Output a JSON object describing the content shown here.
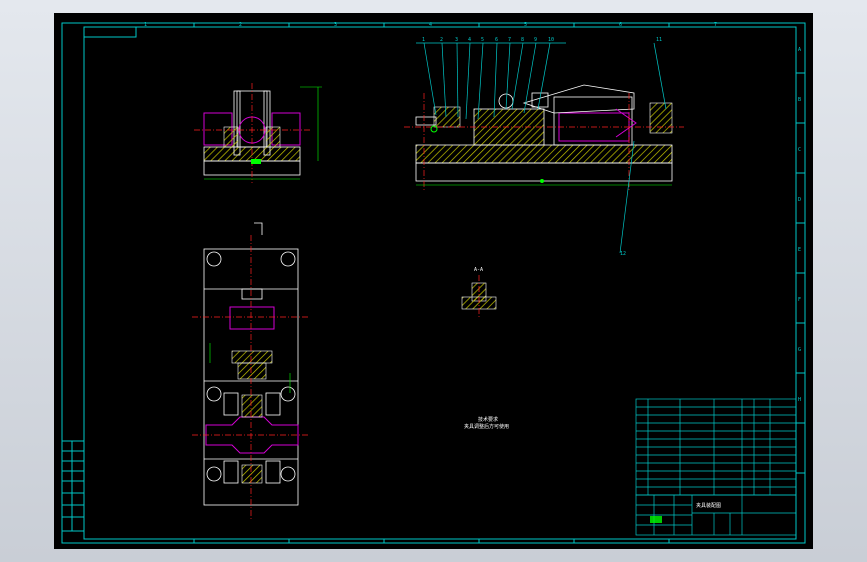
{
  "colors": {
    "background": "#000000",
    "frame": "#00c8c8",
    "outline": "#ffffff",
    "hatch": "#c8c800",
    "purple": "#d400d4",
    "centerline": "#ff2020",
    "dimension": "#00ff00"
  },
  "callouts": [
    "1",
    "2",
    "3",
    "4",
    "5",
    "6",
    "7",
    "8",
    "9",
    "10",
    "11",
    "12"
  ],
  "section_label": "A-A",
  "notes": {
    "heading": "技术要求",
    "line1": "夹具调整后方可使用"
  },
  "title_block": {
    "drawing_name": "夹具装配图"
  },
  "border_marks": {
    "top": [
      "1",
      "2",
      "3",
      "4",
      "5",
      "6",
      "7",
      "8"
    ],
    "side": [
      "A",
      "B",
      "C",
      "D",
      "E",
      "F",
      "G",
      "H",
      "I",
      "J",
      "K",
      "L"
    ]
  }
}
